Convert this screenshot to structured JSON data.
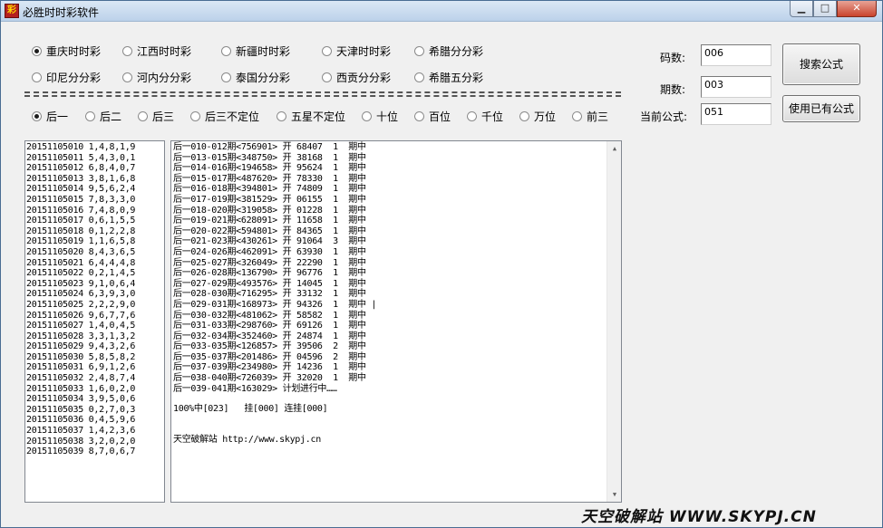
{
  "window": {
    "title": "必胜时时彩软件",
    "app_icon_glyph": "彩",
    "min_glyph": "▁",
    "max_glyph": "□",
    "close_glyph": "✕"
  },
  "lotteries": [
    {
      "label": "重庆时时彩",
      "checked": true
    },
    {
      "label": "江西时时彩",
      "checked": false
    },
    {
      "label": "新疆时时彩",
      "checked": false
    },
    {
      "label": "天津时时彩",
      "checked": false
    },
    {
      "label": "希腊分分彩",
      "checked": false
    },
    {
      "label": "印尼分分彩",
      "checked": false
    },
    {
      "label": "河内分分彩",
      "checked": false
    },
    {
      "label": "泰国分分彩",
      "checked": false
    },
    {
      "label": "西贡分分彩",
      "checked": false
    },
    {
      "label": "希腊五分彩",
      "checked": false
    }
  ],
  "positions": [
    {
      "label": "后一",
      "checked": true
    },
    {
      "label": "后二",
      "checked": false
    },
    {
      "label": "后三",
      "checked": false
    },
    {
      "label": "后三不定位",
      "checked": false
    },
    {
      "label": "五星不定位",
      "checked": false
    },
    {
      "label": "十位",
      "checked": false
    },
    {
      "label": "百位",
      "checked": false
    },
    {
      "label": "千位",
      "checked": false
    },
    {
      "label": "万位",
      "checked": false
    },
    {
      "label": "前三",
      "checked": false
    }
  ],
  "fields": {
    "code_count_label": "码数:",
    "code_count_value": "006",
    "period_count_label": "期数:",
    "period_count_value": "003",
    "current_formula_label": "当前公式:",
    "current_formula_value": "051"
  },
  "buttons": {
    "search_formula": "搜索公式",
    "use_existing_formula": "使用已有公式"
  },
  "draw_history": [
    "20151105010 1,4,8,1,9",
    "20151105011 5,4,3,0,1",
    "20151105012 6,8,4,0,7",
    "20151105013 3,8,1,6,8",
    "20151105014 9,5,6,2,4",
    "20151105015 7,8,3,3,0",
    "20151105016 7,4,8,0,9",
    "20151105017 0,6,1,5,5",
    "20151105018 0,1,2,2,8",
    "20151105019 1,1,6,5,8",
    "20151105020 8,4,3,6,5",
    "20151105021 6,4,4,4,8",
    "20151105022 0,2,1,4,5",
    "20151105023 9,1,0,6,4",
    "20151105024 6,3,9,3,0",
    "20151105025 2,2,2,9,0",
    "20151105026 9,6,7,7,6",
    "20151105027 1,4,0,4,5",
    "20151105028 3,3,1,3,2",
    "20151105029 9,4,3,2,6",
    "20151105030 5,8,5,8,2",
    "20151105031 6,9,1,2,6",
    "20151105032 2,4,8,7,4",
    "20151105033 1,6,0,2,0",
    "20151105034 3,9,5,0,6",
    "20151105035 0,2,7,0,3",
    "20151105036 0,4,5,9,6",
    "20151105037 1,4,2,3,6",
    "20151105038 3,2,0,2,0",
    "20151105039 8,7,0,6,7"
  ],
  "plan_results": [
    "后一010-012期<756901> 开 68407  1  期中",
    "后一013-015期<348750> 开 38168  1  期中",
    "后一014-016期<194658> 开 95624  1  期中",
    "后一015-017期<487620> 开 78330  1  期中",
    "后一016-018期<394801> 开 74809  1  期中",
    "后一017-019期<381529> 开 06155  1  期中",
    "后一018-020期<319058> 开 01228  1  期中",
    "后一019-021期<628091> 开 11658  1  期中",
    "后一020-022期<594801> 开 84365  1  期中",
    "后一021-023期<430261> 开 91064  3  期中",
    "后一024-026期<462091> 开 63930  1  期中",
    "后一025-027期<326049> 开 22290  1  期中",
    "后一026-028期<136790> 开 96776  1  期中",
    "后一027-029期<493576> 开 14045  1  期中",
    "后一028-030期<716295> 开 33132  1  期中",
    "后一029-031期<168973> 开 94326  1  期中 |",
    "后一030-032期<481062> 开 58582  1  期中",
    "后一031-033期<298760> 开 69126  1  期中",
    "后一032-034期<352460> 开 24874  1  期中",
    "后一033-035期<126857> 开 39506  2  期中",
    "后一035-037期<201486> 开 04596  2  期中",
    "后一037-039期<234980> 开 14236  1  期中",
    "后一038-040期<726039> 开 32020  1  期中",
    "后一039-041期<163029> 计划进行中……"
  ],
  "summary": "100%中[023]   挂[000] 连挂[000]",
  "site_line": "天空破解站 http://www.skypj.cn",
  "scroll": {
    "up": "▲",
    "down": "▼"
  },
  "watermark": "天空破解站 WWW.SKYPJ.CN"
}
